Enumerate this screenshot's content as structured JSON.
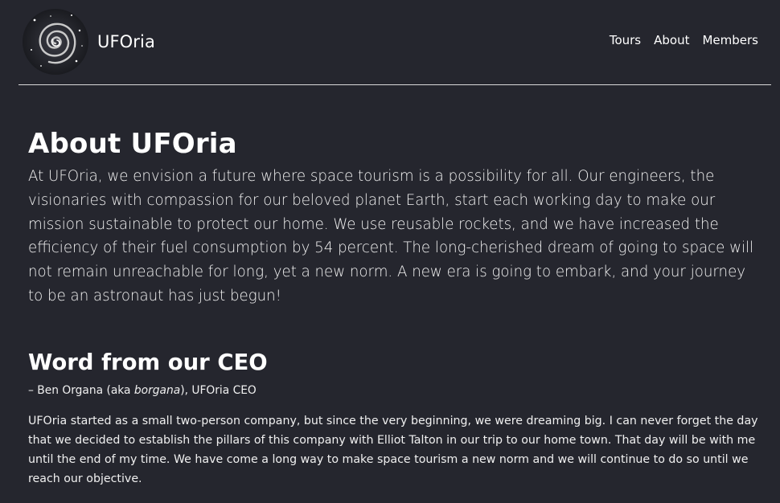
{
  "header": {
    "brand_name": "UFOria",
    "logo_icon": "galaxy-spiral-icon",
    "nav": [
      {
        "label": "Tours"
      },
      {
        "label": "About"
      },
      {
        "label": "Members"
      }
    ]
  },
  "about": {
    "title": "About UFOria",
    "body": "At UFOria, we envision a future where space tourism is a possibility for all. Our engineers, the visionaries with compassion for our beloved planet Earth, start each working day to make our mission sustainable to protect our home. We use reusable rockets, and we have increased the efficiency of their fuel consumption by 54 percent. The long-cherished dream of going to space will not remain unreachable for long, yet a new norm. A new era is going to embark, and your journey to be an astronaut has just begun!"
  },
  "ceo": {
    "title": "Word from our CEO",
    "signature_prefix": "– Ben Organa (aka ",
    "signature_handle": "borgana",
    "signature_suffix": "), UFOria CEO",
    "body": "UFOria started as a small two-person company, but since the very beginning, we were dreaming big. I can never forget the day that we decided to establish the pillars of this company with Elliot Talton in our trip to our home town. That day will be with me until the end of my time. We have come a long way to make space tourism a new norm and we will continue to do so until we reach our objective."
  },
  "colors": {
    "background": "#25262e",
    "text": "#ffffff",
    "divider": "#d9d9d9"
  }
}
